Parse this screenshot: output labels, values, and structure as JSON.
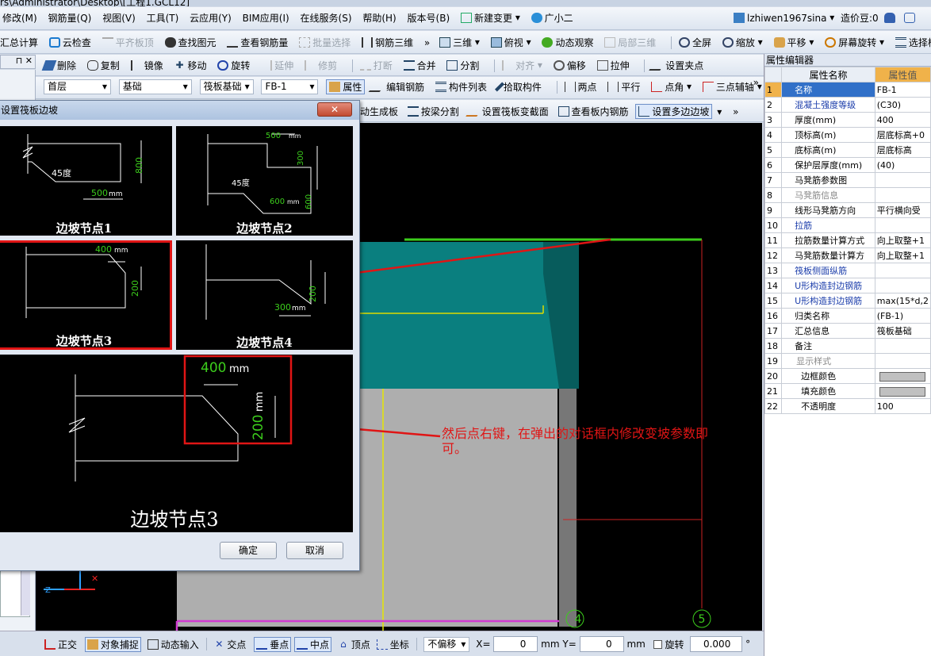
{
  "title_path": "rs\\Administrator\\Desktop\\[工程1.GCL12]",
  "menu": [
    {
      "label": "修改(M)"
    },
    {
      "label": "钢筋量(Q)"
    },
    {
      "label": "视图(V)"
    },
    {
      "label": "工具(T)"
    },
    {
      "label": "云应用(Y)"
    },
    {
      "label": "BIM应用(I)"
    },
    {
      "label": "在线服务(S)"
    },
    {
      "label": "帮助(H)"
    },
    {
      "label": "版本号(B)"
    },
    {
      "label": "新建变更"
    },
    {
      "label": "广小二"
    }
  ],
  "user": {
    "name": "lzhiwen1967sina",
    "beans": "造价豆:0"
  },
  "toolbar1": [
    "汇总计算",
    "云检查",
    "平齐板顶",
    "查找图元",
    "查看钢筋量",
    "批量选择",
    "钢筋三维",
    "三维",
    "俯视",
    "动态观察",
    "局部三维",
    "全屏",
    "缩放",
    "平移",
    "屏幕旋转",
    "选择楼层"
  ],
  "toolbar2": [
    "删除",
    "复制",
    "镜像",
    "移动",
    "旋转",
    "延伸",
    "修剪",
    "打断",
    "合并",
    "分割",
    "对齐",
    "偏移",
    "拉伸",
    "设置夹点"
  ],
  "toolbar3": {
    "floor": "首层",
    "category": "基础",
    "type": "筏板基础",
    "name": "FB-1",
    "items": [
      "属性",
      "编辑钢筋",
      "构件列表",
      "拾取构件",
      "两点",
      "平行",
      "点角",
      "三点辅轴"
    ]
  },
  "toolbar4": [
    "动生成板",
    "按梁分割",
    "设置筏板变截面",
    "查看板内钢筋",
    "设置多边边坡"
  ],
  "dialog": {
    "title": "设置筏板边坡",
    "nodes": [
      {
        "caption": "边坡节点1",
        "angle": "45度",
        "dim1": "800",
        "dim2": "500",
        "unit": "mm"
      },
      {
        "caption": "边坡节点2",
        "angle": "45度",
        "dim1": "500",
        "dim2": "300",
        "dim3": "600",
        "dim4": "600",
        "unit": "mm"
      },
      {
        "caption": "边坡节点3",
        "dim1": "400",
        "dim2": "200",
        "unit": "mm"
      },
      {
        "caption": "边坡节点4",
        "dim1": "200",
        "dim2": "300",
        "unit": "mm"
      }
    ],
    "preview": {
      "caption": "边坡节点3",
      "dim1": "400",
      "dim2": "200",
      "unit": "mm"
    },
    "ok": "确定",
    "cancel": "取消"
  },
  "annotation": "然后点右键，在弹出的对话框内修改变坡参数即可。",
  "axis_label": "5",
  "axis_label2": "4",
  "prop_panel": {
    "title": "属性编辑器",
    "headers": [
      "属性名称",
      "属性值"
    ],
    "rows": [
      {
        "n": "1",
        "name": "名称",
        "value": "FB-1"
      },
      {
        "n": "2",
        "name": "混凝土强度等级",
        "value": "(C30)"
      },
      {
        "n": "3",
        "name": "厚度(mm)",
        "value": "400"
      },
      {
        "n": "4",
        "name": "顶标高(m)",
        "value": "层底标高+0"
      },
      {
        "n": "5",
        "name": "底标高(m)",
        "value": "层底标高"
      },
      {
        "n": "6",
        "name": "保护层厚度(mm)",
        "value": "(40)"
      },
      {
        "n": "7",
        "name": "马凳筋参数图",
        "value": ""
      },
      {
        "n": "8",
        "name": "马凳筋信息",
        "value": ""
      },
      {
        "n": "9",
        "name": "线形马凳筋方向",
        "value": "平行横向受"
      },
      {
        "n": "10",
        "name": "拉筋",
        "value": ""
      },
      {
        "n": "11",
        "name": "拉筋数量计算方式",
        "value": "向上取整+1"
      },
      {
        "n": "12",
        "name": "马凳筋数量计算方",
        "value": "向上取整+1"
      },
      {
        "n": "13",
        "name": "筏板侧面纵筋",
        "value": ""
      },
      {
        "n": "14",
        "name": "U形构造封边钢筋",
        "value": ""
      },
      {
        "n": "15",
        "name": "U形构造封边钢筋",
        "value": "max(15*d,2"
      },
      {
        "n": "16",
        "name": "归类名称",
        "value": "(FB-1)"
      },
      {
        "n": "17",
        "name": "汇总信息",
        "value": "筏板基础"
      },
      {
        "n": "18",
        "name": "备注",
        "value": ""
      },
      {
        "n": "19",
        "name": "显示样式",
        "value": ""
      },
      {
        "n": "20",
        "name": "边框颜色",
        "value": ""
      },
      {
        "n": "21",
        "name": "填充颜色",
        "value": ""
      },
      {
        "n": "22",
        "name": "不透明度",
        "value": "100"
      }
    ]
  },
  "status": {
    "items": [
      "正交",
      "对象捕捉",
      "动态输入",
      "交点",
      "垂点",
      "中点",
      "顶点",
      "坐标"
    ],
    "offset": "不偏移",
    "x_label": "X=",
    "x": "0",
    "y_label": "Y=",
    "y": "0",
    "mm": "mm",
    "rotate": "旋转",
    "rotate_val": "0.000",
    "deg": "°"
  }
}
